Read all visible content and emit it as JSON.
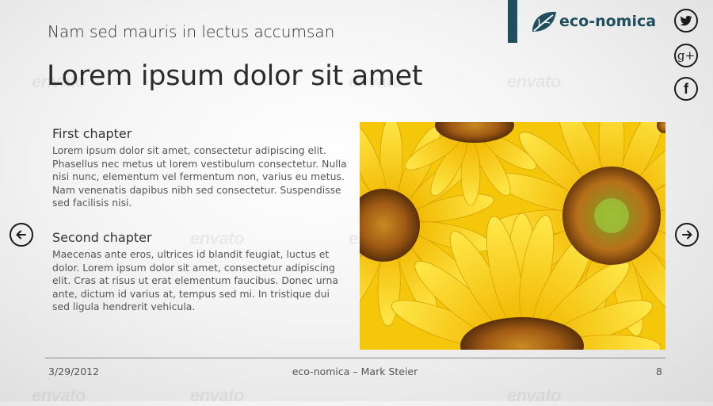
{
  "slide": {
    "subtitle": "Nam sed mauris in lectus accumsan",
    "title": "Lorem ipsum dolor sit amet"
  },
  "brand": {
    "name": "eco-nomica",
    "color": "#1f4e5f"
  },
  "social": [
    {
      "name": "twitter",
      "icon": "twitter-icon"
    },
    {
      "name": "google-plus",
      "icon": "google-plus-icon",
      "glyph": "g+"
    },
    {
      "name": "facebook",
      "icon": "facebook-icon",
      "glyph": "f"
    }
  ],
  "chapters": [
    {
      "heading": "First chapter",
      "body": "Lorem ipsum dolor sit amet, consectetur adipiscing elit. Phasellus nec metus ut lorem vestibulum consectetur. Nulla nisi nunc, elementum vel fermentum non, varius eu metus. Nam venenatis dapibus nibh sed consectetur. Suspendisse sed facilisis nisi."
    },
    {
      "heading": "Second chapter",
      "body": "Maecenas ante eros, ultrices id blandit feugiat, luctus et dolor. Lorem ipsum dolor sit amet, consectetur adipiscing elit. Cras at risus ut erat elementum faucibus. Donec urna ante, dictum id varius at, tempus sed mi. In tristique dui sed ligula hendrerit vehicula."
    }
  ],
  "image": {
    "subject": "sunflowers"
  },
  "navigation": {
    "prev_icon": "arrow-left-icon",
    "next_icon": "arrow-right-icon"
  },
  "footer": {
    "date": "3/29/2012",
    "center": "eco-nomica – Mark Steier",
    "page": "8"
  },
  "watermark": "envato"
}
